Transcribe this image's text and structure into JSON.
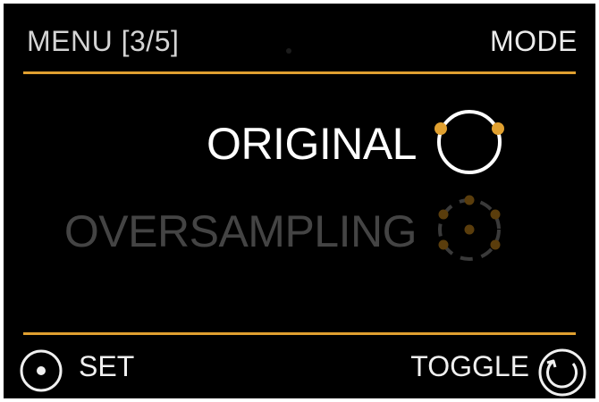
{
  "header": {
    "title": "MENU [3/5]",
    "mode": "MODE"
  },
  "options": [
    {
      "label": "ORIGINAL",
      "state": "selected",
      "icon": "ring-two-dots-icon"
    },
    {
      "label": "OVERSAMPLING",
      "state": "unselected",
      "icon": "dotted-ring-icon"
    }
  ],
  "footer": {
    "set_label": "SET",
    "toggle_label": "TOGGLE",
    "set_icon": "press-button-icon",
    "toggle_icon": "rotate-knob-icon"
  },
  "colors": {
    "background": "#000000",
    "accent": "#e0a030",
    "text_active": "#ffffff",
    "text_inactive": "#444444",
    "header_text": "#d4d4d4"
  }
}
